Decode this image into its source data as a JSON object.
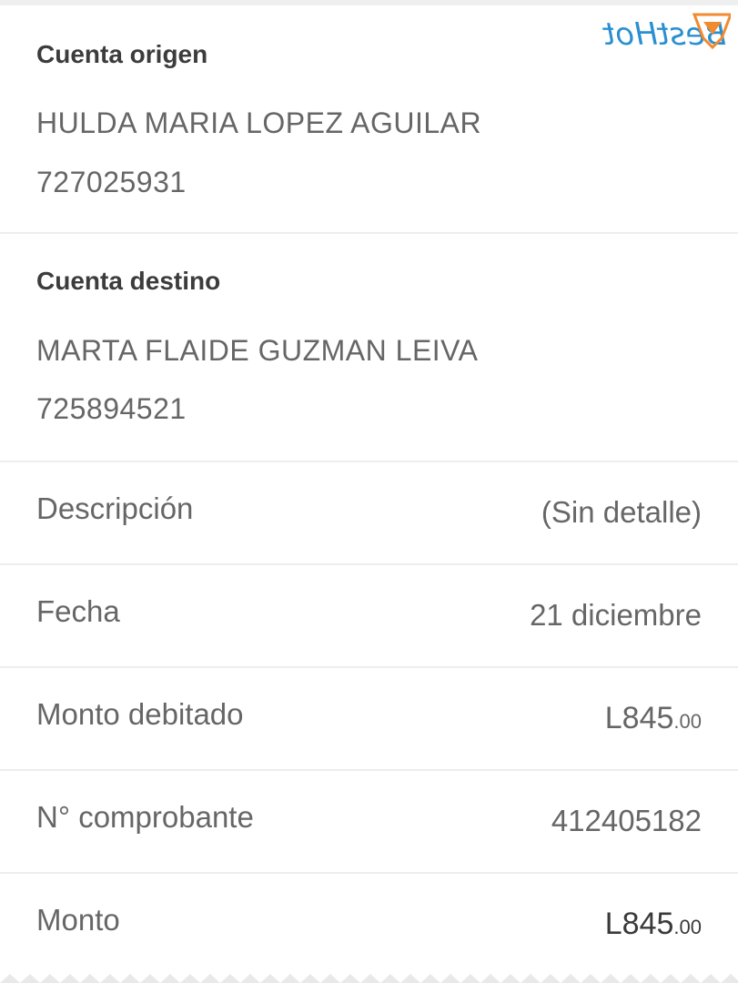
{
  "origin": {
    "title": "Cuenta origen",
    "name": "HULDA MARIA LOPEZ AGUILAR",
    "account": "727025931"
  },
  "destination": {
    "title": "Cuenta destino",
    "name": "MARTA FLAIDE GUZMAN LEIVA",
    "account": "725894521"
  },
  "details": {
    "description_label": "Descripción",
    "description_value": "(Sin detalle)",
    "date_label": "Fecha",
    "date_value": "21 diciembre",
    "debited_label": "Monto debitado",
    "debited_main": "L845",
    "debited_cents": ".00",
    "receipt_label": "N° comprobante",
    "receipt_value": "412405182",
    "amount_label": "Monto",
    "amount_main": "L845",
    "amount_cents": ".00"
  },
  "watermark": {
    "text": "BestHot",
    "icon": "orange-lingerie-icon"
  },
  "colors": {
    "divider": "#ededed",
    "text_primary": "#3c3c3c",
    "text_secondary": "#666666",
    "watermark_blue": "#2a8fd0",
    "watermark_orange": "#f28a2e"
  }
}
